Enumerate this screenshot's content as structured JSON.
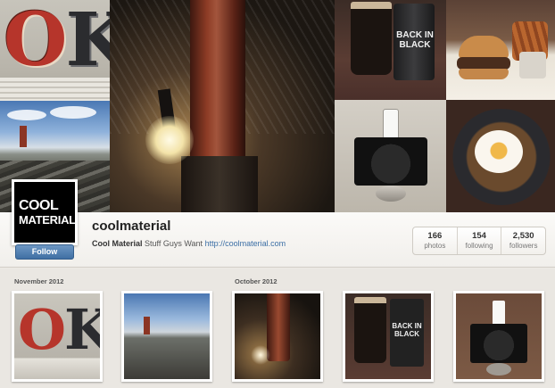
{
  "profile": {
    "avatar_line1": "COOL",
    "avatar_line2": "MATERIAL",
    "follow_label": "Follow",
    "username": "coolmaterial",
    "bio_name": "Cool Material",
    "bio_text": "Stuff Guys Want",
    "bio_link": "http://coolmaterial.com"
  },
  "stats": [
    {
      "value": "166",
      "label": "photos"
    },
    {
      "value": "154",
      "label": "following"
    },
    {
      "value": "2,530",
      "label": "followers"
    }
  ],
  "collage": {
    "ok_letter_o": "O",
    "ok_letter_k": "K",
    "beer_can_text": "BACK IN BLACK"
  },
  "timeline": {
    "months": [
      "November 2012",
      "October 2012"
    ],
    "thumbs": {
      "ok_letter_o": "O",
      "ok_letter_k": "K",
      "beer_can_text": "BACK IN BLACK"
    }
  },
  "colors": {
    "follow_button": "#3f6fa3",
    "link": "#3b6ea5",
    "page_background": "#ece9e4"
  }
}
